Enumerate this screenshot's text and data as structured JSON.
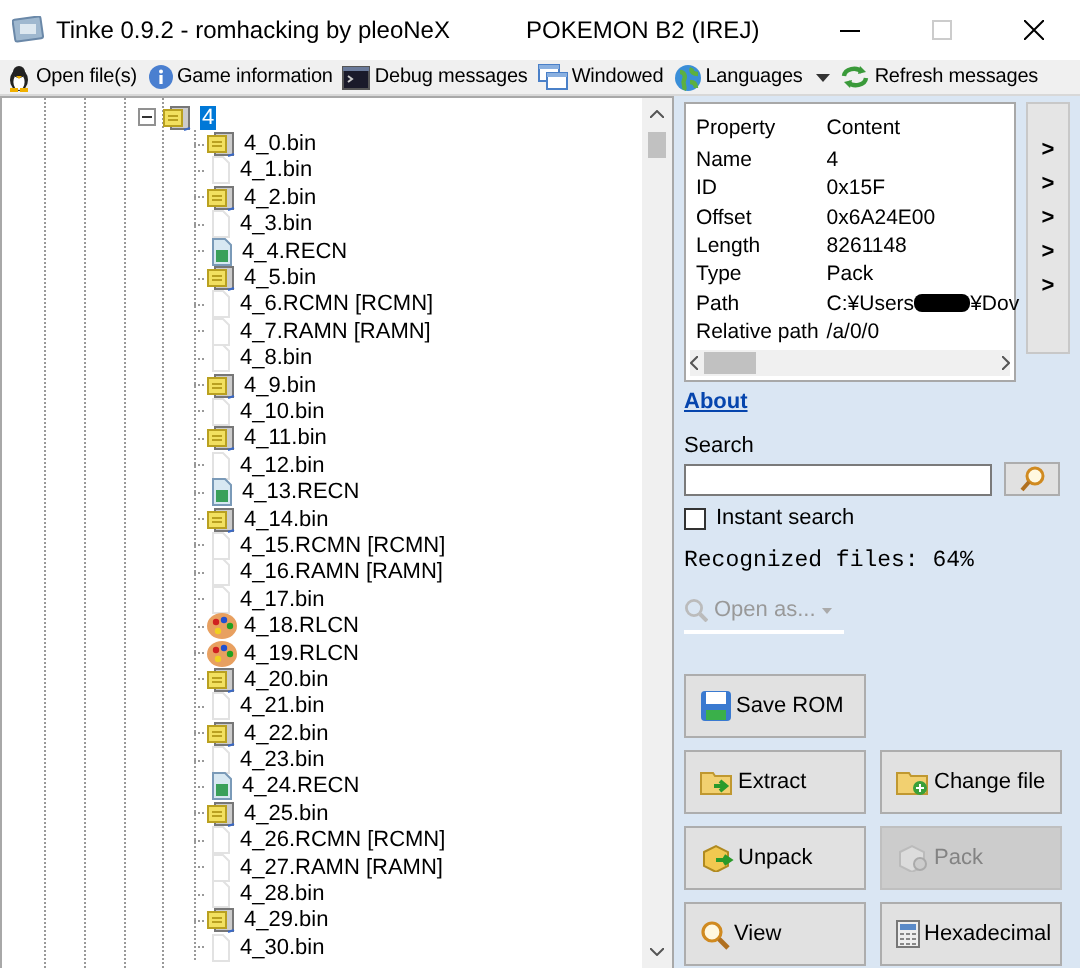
{
  "window": {
    "title": "Tinke 0.9.2 - romhacking by pleoNeX",
    "rom_title": "POKEMON B2 (IREJ)"
  },
  "toolbar": [
    {
      "label": "Open file(s)",
      "kind": "open",
      "dropdown": false
    },
    {
      "label": "Game information",
      "kind": "info",
      "dropdown": false
    },
    {
      "label": "Debug messages",
      "kind": "console",
      "dropdown": false
    },
    {
      "label": "Windowed",
      "kind": "windows",
      "dropdown": false
    },
    {
      "label": "Languages",
      "kind": "globe",
      "dropdown": true
    },
    {
      "label": "Refresh messages",
      "kind": "refresh",
      "dropdown": false
    }
  ],
  "tree": {
    "root": {
      "label": "4",
      "kind": "pack",
      "expanded": true,
      "selected": true,
      "children": [
        {
          "label": "4_0.bin",
          "kind": "pack",
          "selected": false
        },
        {
          "label": "4_1.bin",
          "kind": "file",
          "selected": false
        },
        {
          "label": "4_2.bin",
          "kind": "pack",
          "selected": false
        },
        {
          "label": "4_3.bin",
          "kind": "file",
          "selected": false
        },
        {
          "label": "4_4.RECN",
          "kind": "recn",
          "selected": false
        },
        {
          "label": "4_5.bin",
          "kind": "pack",
          "selected": false
        },
        {
          "label": "4_6.RCMN [RCMN]",
          "kind": "file",
          "selected": false
        },
        {
          "label": "4_7.RAMN [RAMN]",
          "kind": "file",
          "selected": false
        },
        {
          "label": "4_8.bin",
          "kind": "file",
          "selected": false
        },
        {
          "label": "4_9.bin",
          "kind": "pack",
          "selected": false
        },
        {
          "label": "4_10.bin",
          "kind": "file",
          "selected": false
        },
        {
          "label": "4_11.bin",
          "kind": "pack",
          "selected": false
        },
        {
          "label": "4_12.bin",
          "kind": "file",
          "selected": false
        },
        {
          "label": "4_13.RECN",
          "kind": "recn",
          "selected": false
        },
        {
          "label": "4_14.bin",
          "kind": "pack",
          "selected": false
        },
        {
          "label": "4_15.RCMN [RCMN]",
          "kind": "file",
          "selected": false
        },
        {
          "label": "4_16.RAMN [RAMN]",
          "kind": "file",
          "selected": false
        },
        {
          "label": "4_17.bin",
          "kind": "file",
          "selected": false
        },
        {
          "label": "4_18.RLCN",
          "kind": "palette",
          "selected": false
        },
        {
          "label": "4_19.RLCN",
          "kind": "palette",
          "selected": false
        },
        {
          "label": "4_20.bin",
          "kind": "pack",
          "selected": false
        },
        {
          "label": "4_21.bin",
          "kind": "file",
          "selected": false
        },
        {
          "label": "4_22.bin",
          "kind": "pack",
          "selected": false
        },
        {
          "label": "4_23.bin",
          "kind": "file",
          "selected": false
        },
        {
          "label": "4_24.RECN",
          "kind": "recn",
          "selected": false
        },
        {
          "label": "4_25.bin",
          "kind": "pack",
          "selected": false
        },
        {
          "label": "4_26.RCMN [RCMN]",
          "kind": "file",
          "selected": false
        },
        {
          "label": "4_27.RAMN [RAMN]",
          "kind": "file",
          "selected": false
        },
        {
          "label": "4_28.bin",
          "kind": "file",
          "selected": false
        },
        {
          "label": "4_29.bin",
          "kind": "pack",
          "selected": false
        },
        {
          "label": "4_30.bin",
          "kind": "file",
          "selected": false
        }
      ]
    }
  },
  "properties": {
    "columns": [
      "Property",
      "Content"
    ],
    "rows": [
      {
        "name": "Name",
        "kind": "text",
        "value": "4"
      },
      {
        "name": "ID",
        "kind": "text",
        "value": "0x15F"
      },
      {
        "name": "Offset",
        "kind": "text",
        "value": "0x6A24E00"
      },
      {
        "name": "Length",
        "kind": "text",
        "value": "8261148"
      },
      {
        "name": "Type",
        "kind": "text",
        "value": "Pack"
      },
      {
        "name": "Path",
        "kind": "redacted",
        "value": "C:¥Users",
        "value_end": "¥Dov"
      },
      {
        "name": "Relative path",
        "kind": "text",
        "value": "/a/0/0"
      }
    ]
  },
  "side_buttons": [
    ">",
    ">",
    ">",
    ">",
    ">"
  ],
  "about_link": "About",
  "search": {
    "label": "Search"
  },
  "instant_search": {
    "label": "Instant search",
    "checked": false
  },
  "recognized": "Recognized files: 64%",
  "open_as": {
    "label": "Open as...",
    "disabled": true
  },
  "button_rows": [
    [
      {
        "label": "Save ROM",
        "kind": "save",
        "disabled": false
      }
    ],
    [
      {
        "label": "Extract",
        "kind": "extract",
        "disabled": false
      },
      {
        "label": "Change file",
        "kind": "change",
        "disabled": false
      }
    ],
    [
      {
        "label": "Unpack",
        "kind": "unpack",
        "disabled": false
      },
      {
        "label": "Pack",
        "kind": "pack",
        "disabled": true
      }
    ],
    [
      {
        "label": "View",
        "kind": "view",
        "disabled": false
      },
      {
        "label": "Hexadecimal",
        "kind": "hex",
        "disabled": false
      }
    ]
  ]
}
